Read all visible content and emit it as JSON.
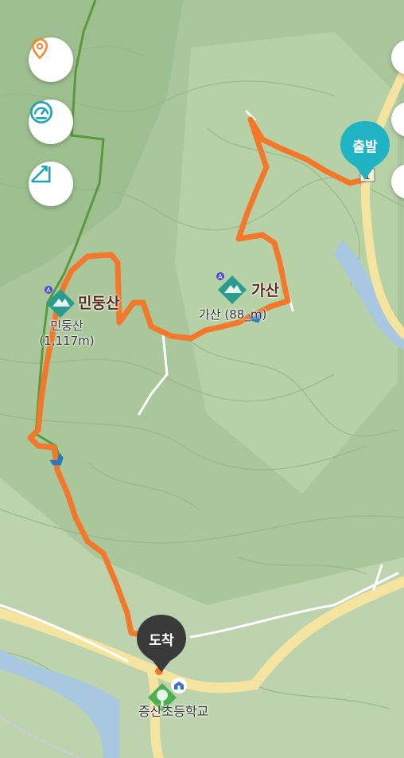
{
  "map": {
    "peaks": [
      {
        "name": "민둥산",
        "sub_name": "민둥산",
        "elevation": "(1,117m)"
      },
      {
        "name": "가산",
        "sub_name": "가산",
        "elevation": "(88_m)"
      }
    ],
    "start_pin": {
      "label": "출발"
    },
    "end_pin": {
      "label": "도착"
    },
    "school_label": "증산초등학교",
    "start_marker_text": "1"
  },
  "controls": {
    "icons": [
      "location-pin-icon",
      "speedometer-icon",
      "slope-icon"
    ]
  },
  "colors": {
    "route": "#f5772a",
    "background": "#a9c79a",
    "road": "#f5e3a0",
    "start_pin": "#1fb3c4",
    "end_pin": "#3a3a3a",
    "peak_badge": "#2a9d8f",
    "trail_green": "#5a9a3e"
  }
}
